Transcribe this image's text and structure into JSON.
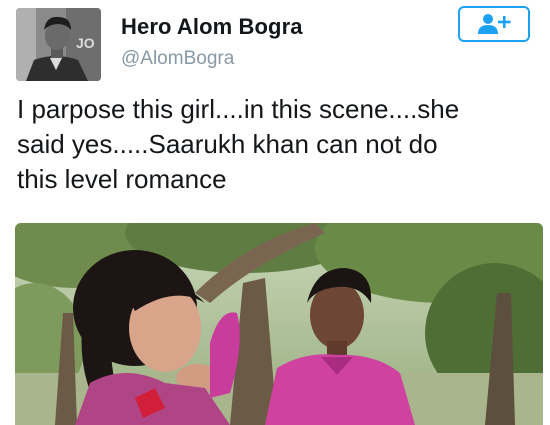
{
  "author": {
    "name": "Hero Alom Bogra",
    "handle": "@AlomBogra"
  },
  "follow_button": {
    "icon": "follow-person-plus-icon"
  },
  "tweet": {
    "lines": [
      "I parpose this girl....in this scene....she",
      "said yes.....Saarukh khan can not do",
      "this level romance"
    ]
  },
  "colors": {
    "accent": "#1da1f2",
    "name_text": "#14171a",
    "handle_text": "#8899a6"
  }
}
